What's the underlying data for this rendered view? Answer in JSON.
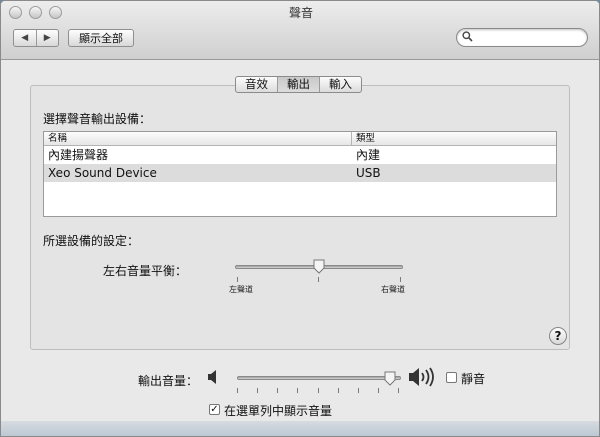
{
  "window": {
    "title": "聲音"
  },
  "toolbar": {
    "back_glyph": "◀",
    "forward_glyph": "▶",
    "show_all_label": "顯示全部",
    "search": {
      "placeholder": "",
      "value": "",
      "icon": "magnifier-icon"
    }
  },
  "tabs": [
    {
      "label": "音效",
      "active": false
    },
    {
      "label": "輸出",
      "active": true
    },
    {
      "label": "輸入",
      "active": false
    }
  ],
  "output": {
    "section_title": "選擇聲音輸出設備：",
    "columns": [
      "名稱",
      "類型"
    ],
    "devices": [
      {
        "name": "內建揚聲器",
        "type": "內建",
        "selected": false
      },
      {
        "name": "Xeo Sound Device",
        "type": "USB",
        "selected": true
      }
    ],
    "settings_title": "所選設備的設定：",
    "balance": {
      "label": "左右音量平衡：",
      "left_label": "左聲道",
      "right_label": "右聲道",
      "value": 0.5
    },
    "help_glyph": "?"
  },
  "volume": {
    "label": "輸出音量：",
    "value": 0.97,
    "mute_label": "靜音",
    "mute_checked": false,
    "show_in_menubar_label": "在選單列中顯示音量",
    "show_in_menubar_checked": true
  }
}
